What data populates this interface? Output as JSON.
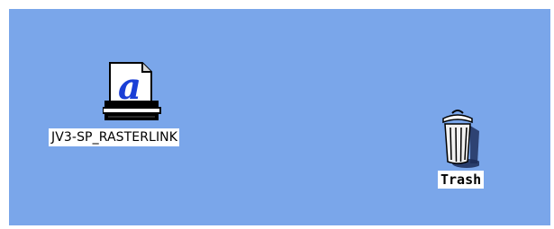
{
  "desktop": {
    "background_color": "#7aa6ea",
    "icons": [
      {
        "label": "JV3-SP_RASTERLINK",
        "icon": "printer-icon"
      },
      {
        "label": "Trash",
        "icon": "trash-icon"
      }
    ]
  }
}
